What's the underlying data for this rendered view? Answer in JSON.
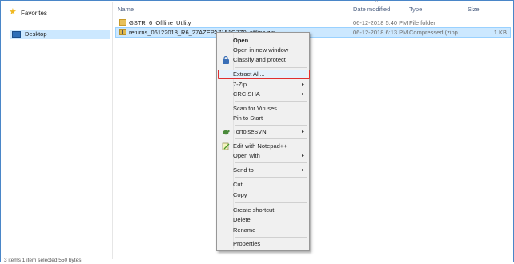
{
  "nav": {
    "favorites": "Favorites",
    "desktop": "Desktop"
  },
  "columns": {
    "name": "Name",
    "date": "Date modified",
    "type": "Type",
    "size": "Size"
  },
  "files": [
    {
      "name": "GSTR_6_Offline_Utility",
      "date": "06-12-2018 5:40 PM",
      "type": "File folder",
      "size": ""
    },
    {
      "name": "returns_06122018_R6_27AZEPA7151G7Z0_offline.zip",
      "date": "06-12-2018 6:13 PM",
      "type": "Compressed (zipp...",
      "size": "1 KB"
    }
  ],
  "status": "3 items     1 item selected  550 bytes",
  "menu": {
    "open": "Open",
    "open_new_window": "Open in new window",
    "classify": "Classify and protect",
    "extract_all": "Extract All...",
    "sevenzip": "7-Zip",
    "crc": "CRC SHA",
    "scan": "Scan for Viruses...",
    "pin": "Pin to Start",
    "tortoise": "TortoiseSVN",
    "notepad": "Edit with Notepad++",
    "open_with": "Open with",
    "send_to": "Send to",
    "cut": "Cut",
    "copy": "Copy",
    "create_shortcut": "Create shortcut",
    "delete": "Delete",
    "rename": "Rename",
    "properties": "Properties"
  },
  "colors": {
    "selection": "#cce8ff",
    "highlight_box": "#e03030",
    "window_border": "#4a86c8"
  }
}
